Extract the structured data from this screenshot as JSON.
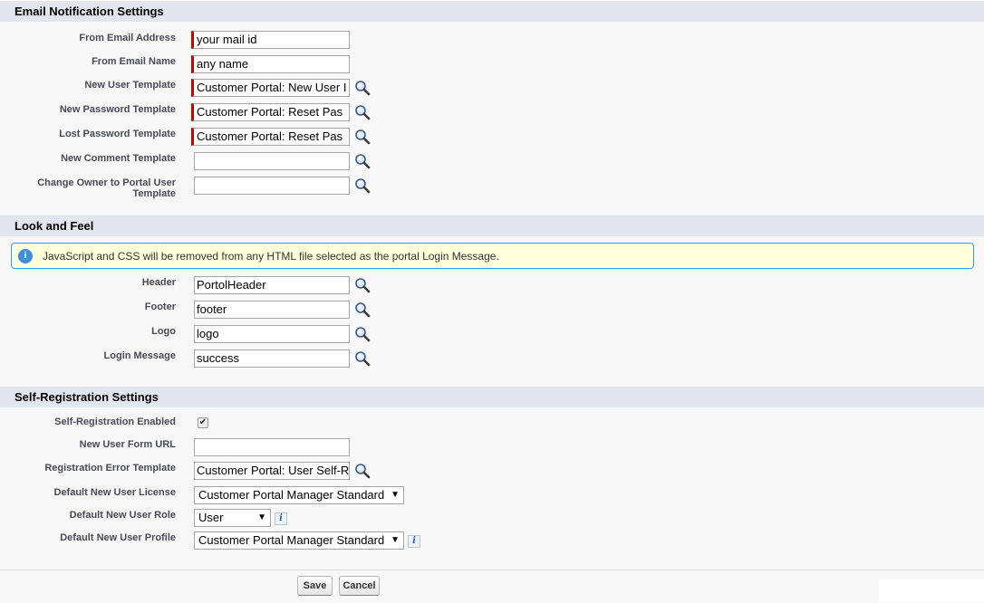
{
  "sections": {
    "email": "Email Notification Settings",
    "look": "Look and Feel",
    "selfreg": "Self-Registration Settings"
  },
  "email": {
    "from_email_address": {
      "label": "From Email Address",
      "value": "your mail id"
    },
    "from_email_name": {
      "label": "From Email Name",
      "value": "any name"
    },
    "new_user_template": {
      "label": "New User Template",
      "value": "Customer Portal: New User I"
    },
    "new_password_template": {
      "label": "New Password Template",
      "value": "Customer Portal:  Reset Pas"
    },
    "lost_password_template": {
      "label": "Lost Password Template",
      "value": "Customer Portal:  Reset Pas"
    },
    "new_comment_template": {
      "label": "New Comment Template",
      "value": ""
    },
    "change_owner_template": {
      "label_line1": "Change Owner to Portal User",
      "label_line2": "Template",
      "value": ""
    }
  },
  "look": {
    "message": "JavaScript and CSS will be removed from any HTML file selected as the portal Login Message.",
    "header": {
      "label": "Header",
      "value": "PortolHeader"
    },
    "footer": {
      "label": "Footer",
      "value": "footer"
    },
    "logo": {
      "label": "Logo",
      "value": "logo"
    },
    "login_message": {
      "label": "Login Message",
      "value": "success"
    }
  },
  "selfreg": {
    "enabled": {
      "label": "Self-Registration Enabled",
      "checked": true
    },
    "form_url": {
      "label": "New User Form URL",
      "value": ""
    },
    "error_template": {
      "label": "Registration Error Template",
      "value": "Customer Portal:  User Self-R"
    },
    "license": {
      "label": "Default New User License",
      "value": "Customer Portal Manager Standard"
    },
    "role": {
      "label": "Default New User Role",
      "value": "User"
    },
    "profile": {
      "label": "Default New User Profile",
      "value": "Customer Portal Manager Standard"
    }
  },
  "buttons": {
    "save": "Save",
    "cancel": "Cancel"
  },
  "icons": {
    "lookup": "magnifier-lookup-icon",
    "info": "info-icon"
  },
  "colors": {
    "required": "#cc0000",
    "header_bg": "#e3e6ee",
    "message_bg": "#ffffdc",
    "message_border": "#3399ff"
  }
}
